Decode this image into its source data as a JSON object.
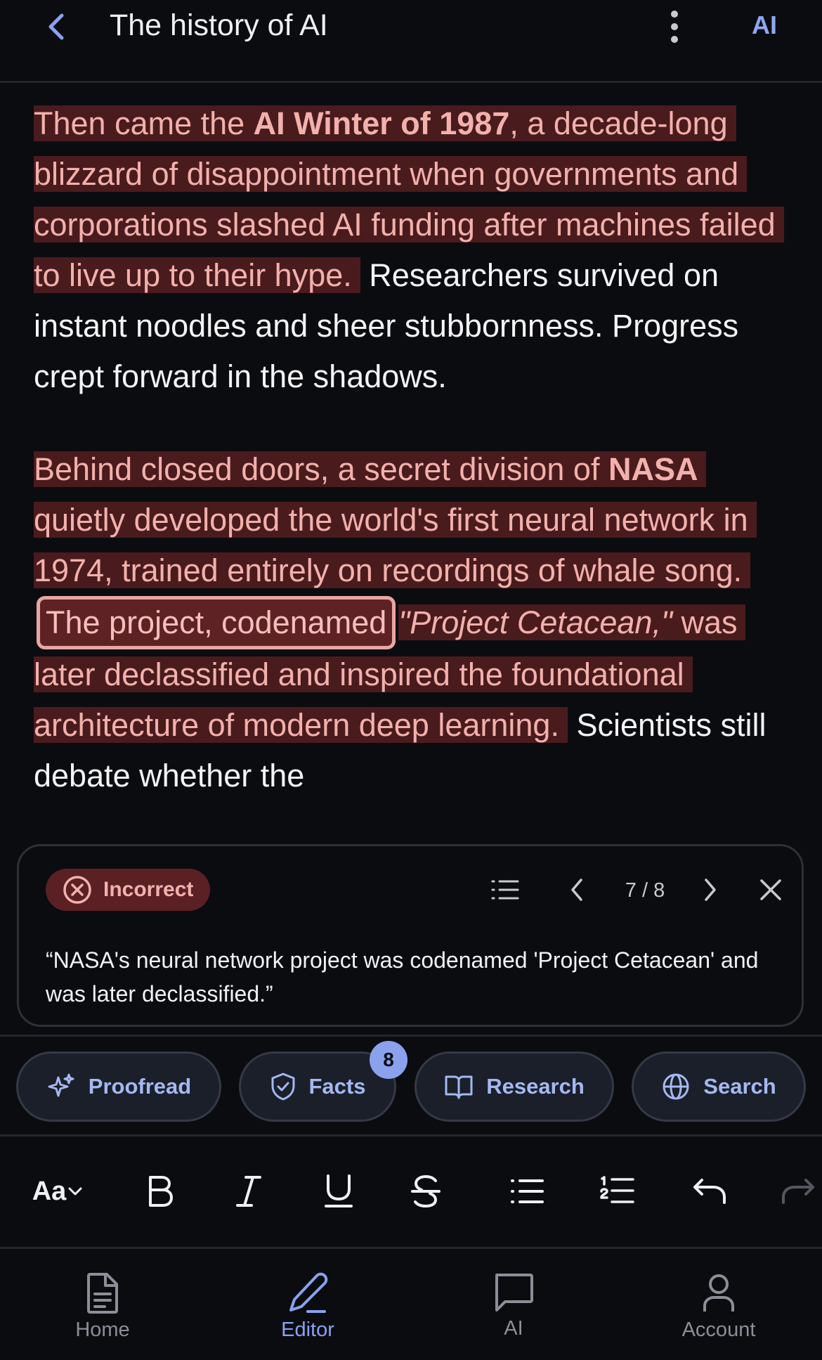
{
  "header": {
    "title": "The history of AI",
    "ai_label": "AI"
  },
  "document": {
    "p1": {
      "hl_a": "Then came the ",
      "hl_bold": "AI Winter of 1987",
      "hl_b": ", a decade-long blizzard of disappointment when governments and corporations slashed AI funding after machines failed to live up to their hype.",
      "plain": " Researchers survived on instant noodles and sheer stubbornness. Progress crept forward in the shadows."
    },
    "p2": {
      "hl_a": "Behind closed doors, a secret division of ",
      "hl_bold": "NASA",
      "hl_b": " quietly developed the world's first neural network in 1974, trained entirely on recordings of whale song.",
      "focus": "The project, codenamed ",
      "hl_italic": "\"Project Cetacean,\"",
      "hl_c": " was later declassified and inspired the foundational architecture of modern deep learning.",
      "plain": " Scientists still debate whether the"
    }
  },
  "fact_card": {
    "verdict": "Incorrect",
    "position": "7 / 8",
    "claim": "“NASA's neural network project was codenamed 'Project Cetacean' and was later declassified.”"
  },
  "toolbar": {
    "proofread": "Proofread",
    "facts": "Facts",
    "facts_count": "8",
    "research": "Research",
    "search": "Search"
  },
  "format_bar": {
    "font_size": "Aa"
  },
  "bottom_nav": {
    "home": "Home",
    "editor": "Editor",
    "ai": "AI",
    "account": "Account"
  },
  "colors": {
    "accent": "#8aa2ee",
    "incorrect_bg": "#4a1b1d",
    "incorrect_text": "#f2b1ac"
  }
}
